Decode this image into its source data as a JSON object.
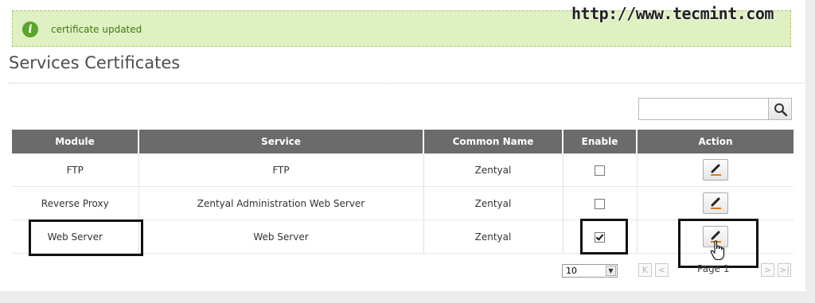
{
  "watermark": "http://www.tecmint.com",
  "message": {
    "icon": "info-icon",
    "text": "certificate updated"
  },
  "page_title": "Services Certificates",
  "search": {
    "placeholder": "",
    "icon": "search-icon"
  },
  "table": {
    "headers": [
      "Module",
      "Service",
      "Common Name",
      "Enable",
      "Action"
    ],
    "rows": [
      {
        "module": "FTP",
        "service": "FTP",
        "common_name": "Zentyal",
        "enabled": false
      },
      {
        "module": "Reverse Proxy",
        "service": "Zentyal Administration Web Server",
        "common_name": "Zentyal",
        "enabled": false
      },
      {
        "module": "Web Server",
        "service": "Web Server",
        "common_name": "Zentyal",
        "enabled": true
      }
    ],
    "action_icon": "pencil-icon"
  },
  "pager": {
    "page_size": "10",
    "page_label": "Page 1",
    "first": "K",
    "prev": "<",
    "next": ">",
    "last": ">|"
  },
  "colors": {
    "header_bg": "#6b6b6b",
    "message_bg": "#dff0c2",
    "message_text": "#3f7a10",
    "pencil_accent": "#e07b10"
  }
}
